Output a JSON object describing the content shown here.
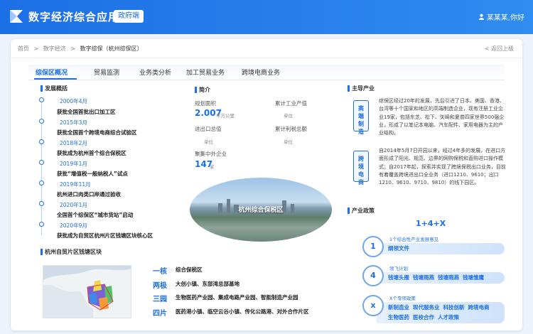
{
  "header": {
    "app_title": "数字经济综合应用",
    "gov_badge": "政府端",
    "user_name": "某某某,你好",
    "logo_icon": "app-logo-icon",
    "user_icon": "user-icon"
  },
  "breadcrumb": {
    "items": [
      "首页",
      "数字经济",
      "数字综保（杭州综保区）"
    ],
    "separator": ">",
    "back_label": "< 返回上级"
  },
  "tabs": [
    {
      "label": "综保区概况",
      "active": true
    },
    {
      "label": "贸易监测",
      "active": false
    },
    {
      "label": "业务类分析",
      "active": false
    },
    {
      "label": "加工贸易业务",
      "active": false
    },
    {
      "label": "跨境电商业务",
      "active": false
    }
  ],
  "development": {
    "title": "发展概括",
    "events": [
      {
        "date": "2000年4月",
        "text": "获批全国首批出口加工区"
      },
      {
        "date": "2015年3月",
        "text": "获批全国首个跨境电商综合试验区"
      },
      {
        "date": "2018年2月",
        "text": "获批成为杭州首个综合保税区"
      },
      {
        "date": "2019年1月",
        "text": "获批“增值税一般纳税人”试点"
      },
      {
        "date": "2019年11月",
        "text": "杭州进口肉类口岸通过验收"
      },
      {
        "date": "2020年1月",
        "text": "全国首个综保区“城市货站”启动"
      },
      {
        "date": "2020年9月",
        "text": "获批成为自贸区杭州片区钱塘区块核心区"
      }
    ]
  },
  "intro": {
    "title": "简介",
    "stats": [
      {
        "label": "规划面积",
        "value": "2.007",
        "unit": "平方公里"
      },
      {
        "label": "累计工业产值",
        "value": "",
        "unit": "单位"
      },
      {
        "label": "进出口总值",
        "value": "",
        "unit": "单位"
      },
      {
        "label": "累计利税总额",
        "value": "",
        "unit": "单位"
      },
      {
        "label": "聚集中外企业",
        "value": "147",
        "unit": "家"
      }
    ],
    "photo_caption": "杭州综合保税区"
  },
  "industry": {
    "title": "主导产业",
    "badge1": "高端制造",
    "text1": "综保区经过20年的发展，先后引进了日本、美国、香港、台湾等十个国家和地区的高端制造企业，现有注册工业企业19家，包括东芝、松下、矢崎和夏普四家世界500强企业，形成了以笔记本电脑、汽车配件、家用电器为主的产业结构。",
    "badge2": "跨境电商",
    "text2": "自2014年5月7日开园以来，经过4年多的发展，在进口方面形成了阳光、规范、边界的网购保税和直购进口操作模式；自2017年起，探索并实现了跨境保税出口业务，目前有着覆盖跨境进出口全业务（进口1210、9610；出口1210、9610、9710、9810）的线下园区。"
  },
  "policy": {
    "title": "产业政策",
    "headline": "1+4+X",
    "rows": [
      {
        "symbol": "1",
        "subtitle": "1个综合性产业发展意见",
        "items": [
          "纲领文件"
        ]
      },
      {
        "symbol": "4",
        "subtitle": "领飞计划",
        "items": [
          "钱塘头雁",
          "钱塘雨燕",
          "钱塘雨燕",
          "钱塘雏鹰"
        ]
      },
      {
        "symbol": "x",
        "subtitle": "X个专项政策",
        "items": [
          "新制造业",
          "现代服务业",
          "科技创新",
          "跨境电商",
          "生物医药",
          "医校合作",
          "人才政策"
        ]
      }
    ]
  },
  "block": {
    "title": "杭州自贸片区钱塘区块",
    "layout": [
      {
        "key": "一核",
        "value": "综合保税区"
      },
      {
        "key": "两极",
        "value": "大创小镇、东部湾总部基地"
      },
      {
        "key": "三园",
        "value": "生物医药产业园、集成电路产业园、智能制造产业园"
      },
      {
        "key": "四片",
        "value": "医药港小镇、临空云谷小镇、传化公路港、对外合作片区"
      }
    ]
  },
  "colors": {
    "primary": "#1c6fe6",
    "header_gradient_end": "#2f8cf0",
    "background": "#eef3fb"
  }
}
